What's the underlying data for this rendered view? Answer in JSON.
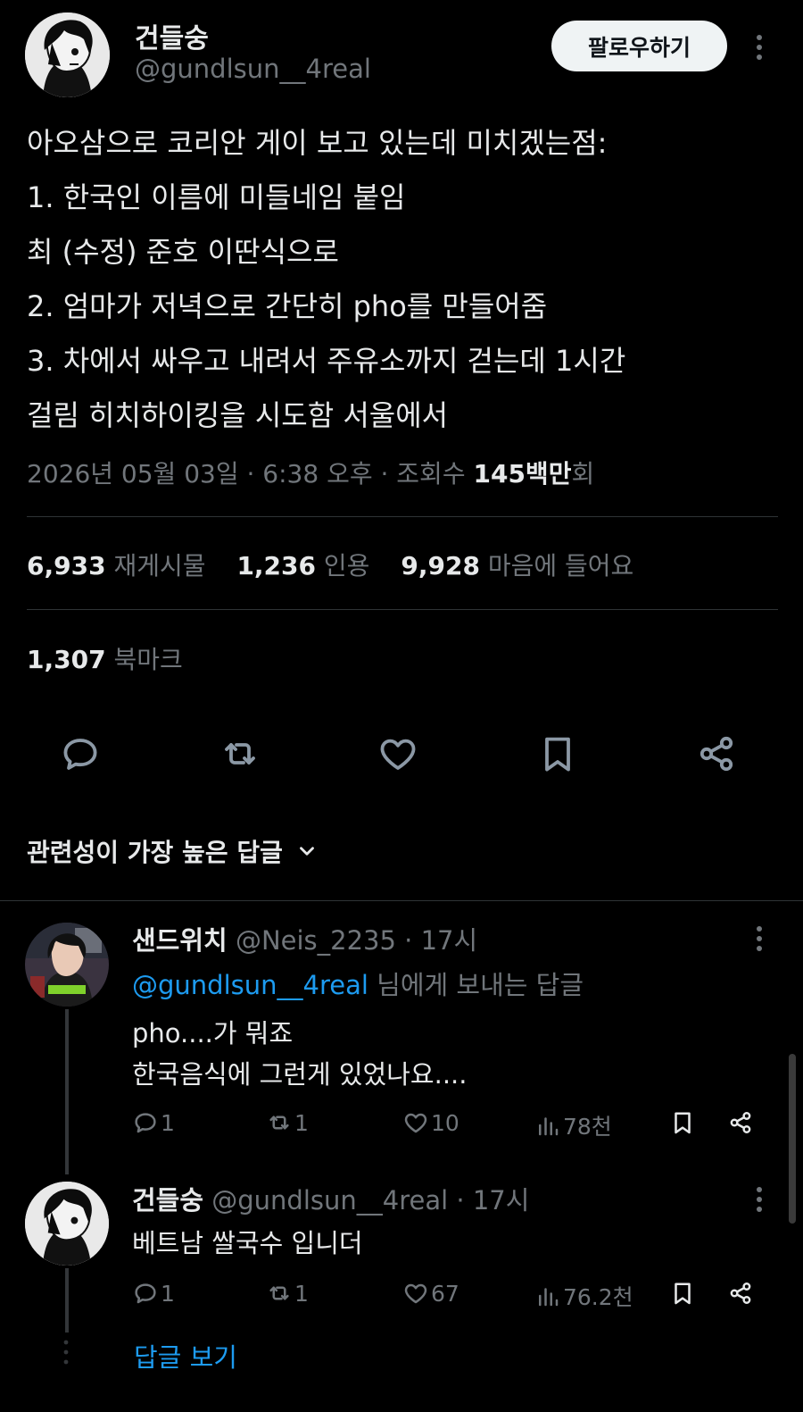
{
  "author": {
    "name": "건들숭",
    "handle": "@gundlsun__4real",
    "follow_label": "팔로우하기"
  },
  "tweet": {
    "lines": [
      "아오삼으로 코리안 게이 보고 있는데 미치겠는점:",
      "1. 한국인 이름에 미들네임 붙임",
      "최 (수정) 준호 이딴식으로",
      "2. 엄마가 저녁으로 간단히 pho를 만들어줌",
      "3. 차에서 싸우고 내려서 주유소까지 걷는데 1시간",
      "걸림 히치하이킹을 시도함 서울에서"
    ],
    "date": "2026년 05월 03일 · 6:38 오후 · 조회수 ",
    "views": "145백만",
    "views_suffix": "회"
  },
  "stats": {
    "retweets": "6,933",
    "retweets_label": "재게시물",
    "quotes": "1,236",
    "quotes_label": "인용",
    "likes": "9,928",
    "likes_label": "마음에 들어요",
    "bookmarks": "1,307",
    "bookmarks_label": "북마크"
  },
  "actions": [
    "reply-icon",
    "retweet-icon",
    "like-icon",
    "bookmark-icon",
    "share-icon"
  ],
  "sort_label": "관련성이 가장 높은 답글",
  "replies": [
    {
      "name": "샌드위치",
      "handle_time": " @Neis_2235 · 17시",
      "mention": "@gundlsun__4real",
      "reply_to_suffix": " 님에게 보내는 답글",
      "lines": [
        "pho....가 뭐죠",
        "한국음식에 그런게 있었나요...."
      ],
      "replies": "1",
      "retweets": "1",
      "likes": "10",
      "views": "78천"
    },
    {
      "name": "건들숭",
      "handle_time": " @gundlsun__4real · 17시",
      "lines": [
        "베트남 쌀국수 입니더"
      ],
      "replies": "1",
      "retweets": "1",
      "likes": "67",
      "views": "76.2천"
    }
  ],
  "show_replies_label": "답글 보기",
  "colors": {
    "background": "#000000",
    "text": "#e7e9ea",
    "muted": "#71767b",
    "link": "#1d9bf0",
    "divider": "#2f3336"
  }
}
